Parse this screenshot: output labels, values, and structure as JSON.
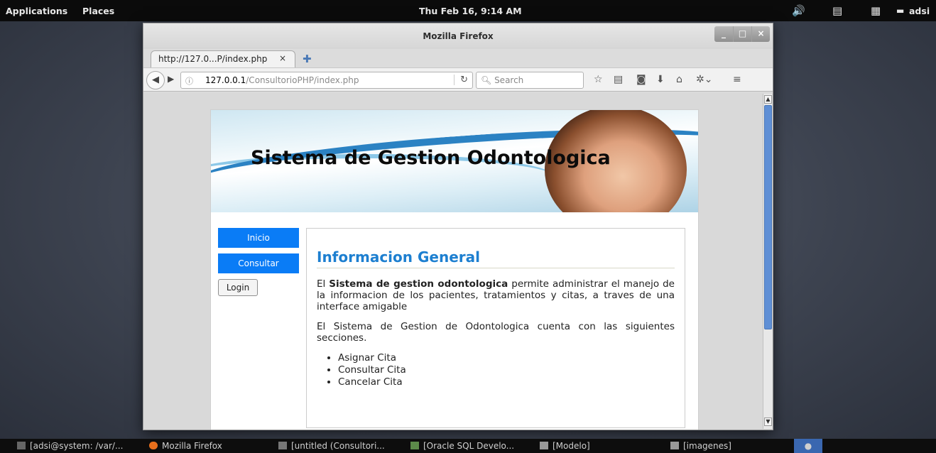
{
  "topbar": {
    "applications": "Applications",
    "places": "Places",
    "clock": "Thu Feb 16,  9:14 AM",
    "user": "adsi",
    "icons": [
      "volume-icon",
      "battery-icon",
      "user-switch-icon",
      "chat-icon"
    ]
  },
  "window": {
    "title": "Mozilla Firefox",
    "controls": [
      "_",
      "□",
      "×"
    ]
  },
  "tab": {
    "label": "http://127.0...P/index.php",
    "close": "×",
    "new_tab": "✚"
  },
  "navbar": {
    "url_host": "127.0.0.1",
    "url_path": "/ConsultorioPHP/index.php",
    "search_placeholder": "Search"
  },
  "page": {
    "banner_title": "Sistema de Gestion Odontologica",
    "sidebar": {
      "inicio": "Inicio",
      "consultar": "Consultar",
      "login": "Login"
    },
    "main": {
      "heading": "Informacion General",
      "p1_prefix": "El ",
      "p1_bold": "Sistema de gestion odontologica",
      "p1_rest": " permite administrar el manejo de la informacion de los pacientes, tratamientos y citas, a traves de una interface amigable",
      "p2": "El Sistema de Gestion de Odontologica cuenta con las siguientes secciones.",
      "list": [
        "Asignar Cita",
        "Consultar Cita",
        "Cancelar Cita"
      ]
    }
  },
  "taskbar": {
    "items": [
      "[adsi@system: /var/...",
      "Mozilla Firefox",
      "[untitled (Consultori...",
      "[Oracle SQL Develo...",
      "[Modelo]",
      "[imagenes]"
    ]
  },
  "colors": {
    "accent_blue": "#0a7cf6",
    "heading_blue": "#1d7fd0",
    "scroll_thumb": "#5f8fd5"
  }
}
